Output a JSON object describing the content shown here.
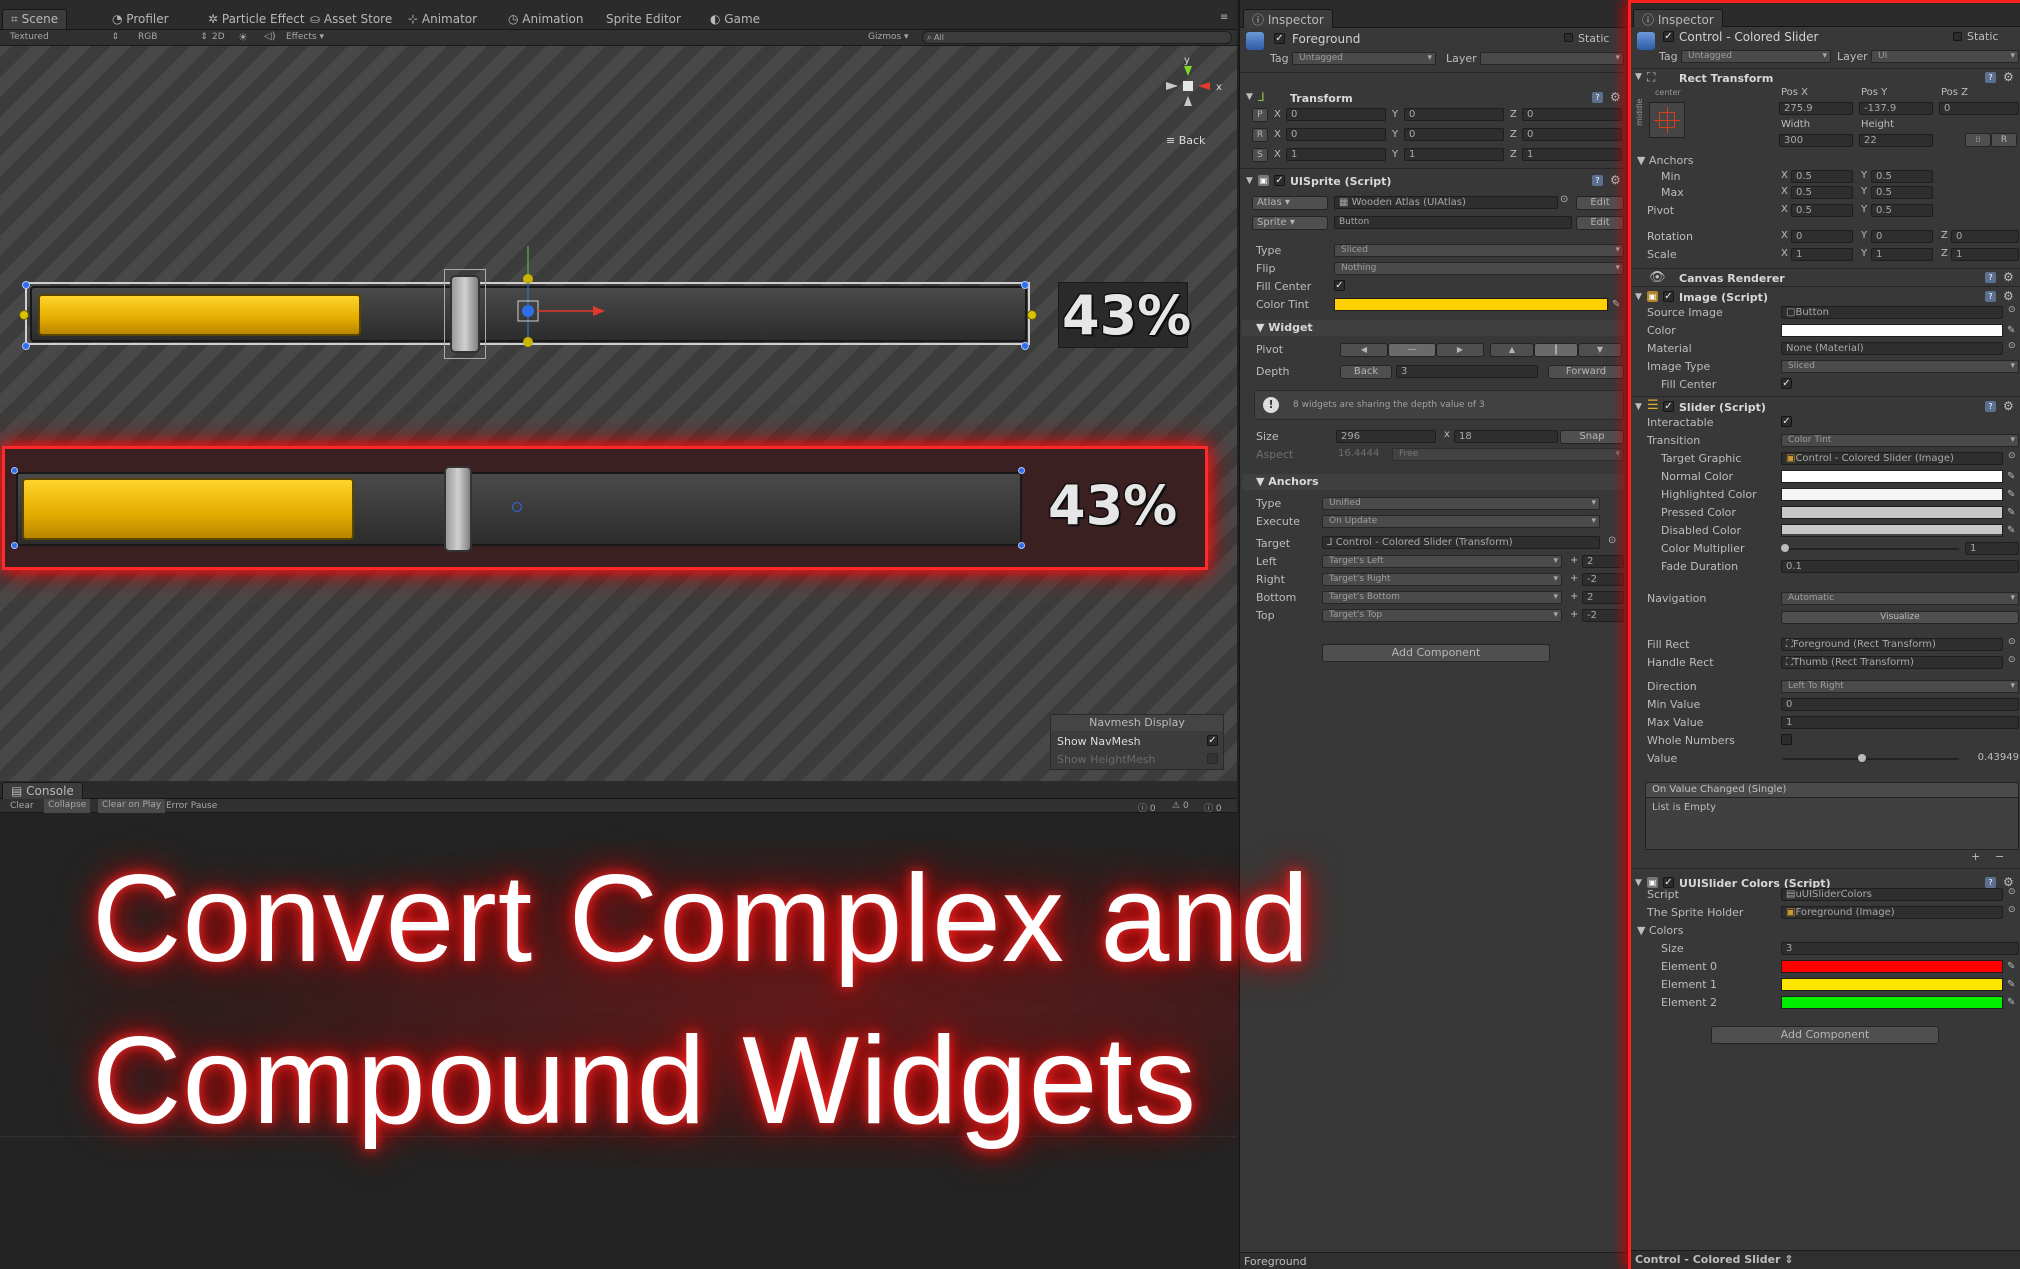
{
  "scene_panel": {
    "tabs": [
      "Scene",
      "Profiler",
      "Particle Effect",
      "Asset Store",
      "Animator",
      "Animation",
      "Sprite Editor",
      "Game"
    ],
    "toolbar": [
      "Textured",
      "RGB",
      "2D",
      "Effects",
      "Gizmos",
      "All"
    ],
    "gizmo": {
      "y_label": "y",
      "x_label": "x",
      "back_label": "Back"
    },
    "slider1_pct": "43%",
    "slider2_pct": "43%",
    "slider_value_fraction": 0.43949,
    "navmesh": {
      "title": "Navmesh Display",
      "show_navmesh": "Show NavMesh",
      "show_heightmesh": "Show HeightMesh"
    }
  },
  "console_panel": {
    "tab": "Console",
    "buttons": [
      "Clear",
      "Collapse",
      "Clear on Play",
      "Error Pause"
    ],
    "counts": [
      "0",
      "0",
      "0"
    ]
  },
  "headline": {
    "line1": "Convert Complex and",
    "line2": "Compound Widgets"
  },
  "inspector_left": {
    "tab": "Inspector",
    "object_name": "Foreground",
    "static_label": "Static",
    "tag_label": "Tag",
    "tag_value": "Untagged",
    "layer_label": "Layer",
    "layer_value": "",
    "transform": {
      "title": "Transform",
      "rows": [
        {
          "k": "P",
          "x": "0",
          "y": "0",
          "z": "0"
        },
        {
          "k": "R",
          "x": "0",
          "y": "0",
          "z": "0"
        },
        {
          "k": "S",
          "x": "1",
          "y": "1",
          "z": "1"
        }
      ]
    },
    "uisprite": {
      "title": "UISprite (Script)",
      "atlas_label": "Atlas",
      "atlas_value": "Wooden Atlas (UIAtlas)",
      "edit": "Edit",
      "sprite_label": "Sprite",
      "sprite_value": "Button",
      "type_label": "Type",
      "type_value": "Sliced",
      "flip_label": "Flip",
      "flip_value": "Nothing",
      "fill_center_label": "Fill Center",
      "color_tint_label": "Color Tint",
      "color_tint": "#ffd000"
    },
    "widget": {
      "title": "Widget",
      "pivot_label": "Pivot",
      "depth_label": "Depth",
      "back": "Back",
      "depth_value": "3",
      "forward": "Forward",
      "warning": "8 widgets are sharing the depth value of 3",
      "size_label": "Size",
      "size_w": "296",
      "size_x": "x",
      "size_h": "18",
      "snap": "Snap",
      "aspect_label": "Aspect",
      "aspect_value": "16.4444",
      "aspect_mode": "Free"
    },
    "anchors": {
      "title": "Anchors",
      "type_label": "Type",
      "type_value": "Unified",
      "execute_label": "Execute",
      "execute_value": "On Update",
      "target_label": "Target",
      "target_value": "Control - Colored Slider (Transform)",
      "rows": [
        {
          "label": "Left",
          "rel": "Target's Left",
          "plus": "+",
          "val": "2"
        },
        {
          "label": "Right",
          "rel": "Target's Right",
          "plus": "+",
          "val": "-2"
        },
        {
          "label": "Bottom",
          "rel": "Target's Bottom",
          "plus": "+",
          "val": "2"
        },
        {
          "label": "Top",
          "rel": "Target's Top",
          "plus": "+",
          "val": "-2"
        }
      ]
    },
    "add_component": "Add Component",
    "footer": "Foreground"
  },
  "inspector_right": {
    "tab": "Inspector",
    "object_name": "Control - Colored Slider",
    "static_label": "Static",
    "tag_label": "Tag",
    "tag_value": "Untagged",
    "layer_label": "Layer",
    "layer_value": "UI",
    "rect": {
      "title": "Rect Transform",
      "anchor_preset_top": "center",
      "anchor_preset_side": "middle",
      "posx_label": "Pos X",
      "posy_label": "Pos Y",
      "posz_label": "Pos Z",
      "posx": "275.9",
      "posy": "-137.9",
      "posz": "0",
      "width_label": "Width",
      "height_label": "Height",
      "width": "300",
      "height": "22",
      "r_btn": "R",
      "anchors_label": "Anchors",
      "min_label": "Min",
      "min_x": "0.5",
      "min_y": "0.5",
      "max_label": "Max",
      "max_x": "0.5",
      "max_y": "0.5",
      "pivot_label": "Pivot",
      "pivot_x": "0.5",
      "pivot_y": "0.5",
      "rotation_label": "Rotation",
      "rot_x": "0",
      "rot_y": "0",
      "rot_z": "0",
      "scale_label": "Scale",
      "scale_x": "1",
      "scale_y": "1",
      "scale_z": "1",
      "x": "X",
      "y": "Y",
      "z": "Z"
    },
    "canvas_renderer": "Canvas Renderer",
    "image": {
      "title": "Image (Script)",
      "source_label": "Source Image",
      "source_value": "Button",
      "color_label": "Color",
      "material_label": "Material",
      "material_value": "None (Material)",
      "image_type_label": "Image Type",
      "image_type_value": "Sliced",
      "fill_center_label": "Fill Center"
    },
    "slider": {
      "title": "Slider (Script)",
      "interactable_label": "Interactable",
      "transition_label": "Transition",
      "transition_value": "Color Tint",
      "target_graphic_label": "Target Graphic",
      "target_graphic_value": "Control - Colored Slider (Image)",
      "normal_label": "Normal Color",
      "highlighted_label": "Highlighted Color",
      "pressed_label": "Pressed Color",
      "disabled_label": "Disabled Color",
      "color_multiplier_label": "Color Multiplier",
      "color_multiplier_value": "1",
      "fade_label": "Fade Duration",
      "fade_value": "0.1",
      "navigation_label": "Navigation",
      "navigation_value": "Automatic",
      "visualize": "Visualize",
      "fill_rect_label": "Fill Rect",
      "fill_rect_value": "Foreground (Rect Transform)",
      "handle_rect_label": "Handle Rect",
      "handle_rect_value": "Thumb (Rect Transform)",
      "direction_label": "Direction",
      "direction_value": "Left To Right",
      "min_label": "Min Value",
      "min_value": "0",
      "max_label": "Max Value",
      "max_value": "1",
      "whole_label": "Whole Numbers",
      "value_label": "Value",
      "value_value": "0.43949",
      "event_title": "On Value Changed (Single)",
      "event_empty": "List is Empty",
      "plus": "+",
      "minus": "−"
    },
    "uuislider": {
      "title": "UUISlider Colors (Script)",
      "script_label": "Script",
      "script_value": "uUISliderColors",
      "sprite_holder_label": "The Sprite Holder",
      "sprite_holder_value": "Foreground (Image)",
      "colors_label": "Colors",
      "size_label": "Size",
      "size_value": "3",
      "elements": [
        {
          "label": "Element 0",
          "color": "#ff0000"
        },
        {
          "label": "Element 1",
          "color": "#ffe600"
        },
        {
          "label": "Element 2",
          "color": "#00ee00"
        }
      ]
    },
    "add_component": "Add Component",
    "footer": "Control - Colored Slider"
  }
}
